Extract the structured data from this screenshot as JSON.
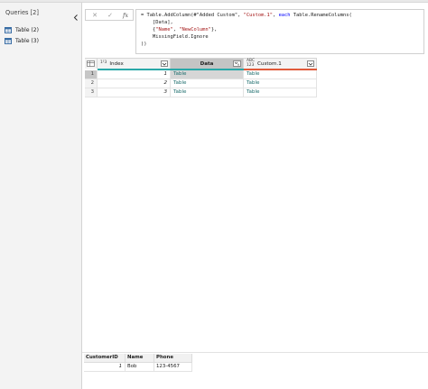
{
  "queries": {
    "header": "Queries [2]",
    "items": [
      {
        "label": "Table (2)",
        "icon": "table-icon"
      },
      {
        "label": "Table (3)",
        "icon": "table-icon"
      }
    ]
  },
  "formula": {
    "buttons": {
      "cancel": "✕",
      "commit": "✓",
      "fx": "fx"
    },
    "lines": [
      {
        "a": "= Table.AddColumn(#\"Added Custom\", ",
        "s1": "\"Custom.1\"",
        "b": ", ",
        "kw": "each",
        "c": " Table.RenameColumns("
      },
      {
        "a": "    [Data],"
      },
      {
        "a": "    {",
        "s1": "\"Name\"",
        "b": ", ",
        "s2": "\"NewColumn\"",
        "c": "},"
      },
      {
        "a": "    MissingField.Ignore"
      },
      {
        "a": "))"
      }
    ]
  },
  "grid": {
    "columns": [
      {
        "name": "Index",
        "type": "1²3",
        "bar_color": "#2aa8a8"
      },
      {
        "name": "Data",
        "type": "",
        "bar_color": "#2aa8a8"
      },
      {
        "name": "Custom.1",
        "type": "ABC 123",
        "bar_color": "#e05a3a"
      }
    ],
    "rows": [
      {
        "rownum": "1",
        "index": "1",
        "data": "Table",
        "custom": "Table"
      },
      {
        "rownum": "2",
        "index": "2",
        "data": "Table",
        "custom": "Table"
      },
      {
        "rownum": "3",
        "index": "3",
        "data": "Table",
        "custom": "Table"
      }
    ]
  },
  "preview": {
    "columns": [
      "CustomerID",
      "Name",
      "Phone"
    ],
    "row": [
      "1",
      "Bob",
      "123-4567"
    ]
  }
}
